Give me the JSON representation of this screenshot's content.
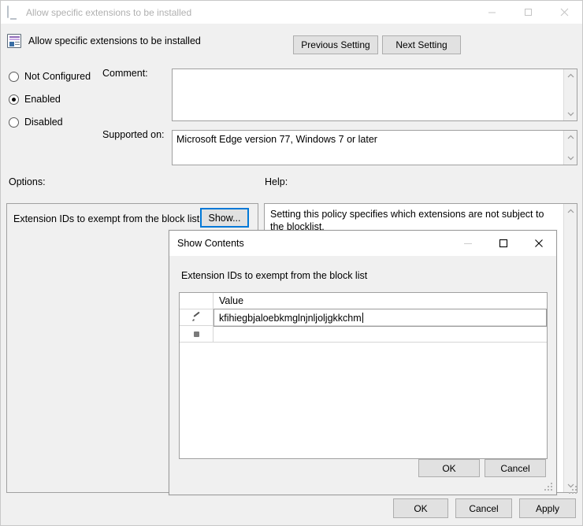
{
  "window": {
    "titlebar_title": "Allow specific extensions to be installed",
    "icon": "monitor-icon",
    "minimize": "–",
    "maximize": "□",
    "close": "✕"
  },
  "policy": {
    "icon": "policy-setting-icon",
    "title": "Allow specific extensions to be installed",
    "prev_setting": "Previous Setting",
    "next_setting": "Next Setting"
  },
  "state": {
    "options": [
      {
        "label": "Not Configured",
        "selected": false
      },
      {
        "label": "Enabled",
        "selected": true
      },
      {
        "label": "Disabled",
        "selected": false
      }
    ]
  },
  "comment": {
    "label": "Comment:",
    "value": "",
    "scroll_up": "⌃",
    "scroll_down": "⌄"
  },
  "supported_on": {
    "label": "Supported on:",
    "value": "Microsoft Edge version 77, Windows 7 or later",
    "scroll_up": "⌃",
    "scroll_down": "⌄"
  },
  "panes": {
    "options_label": "Options:",
    "help_label": "Help:"
  },
  "options": {
    "setting_label": "Extension IDs to exempt from the block list",
    "show_button": "Show..."
  },
  "help": {
    "text": "Setting this policy specifies which extensions are not subject to the blocklist.",
    "scroll_up": "⌃",
    "scroll_down": "⌄"
  },
  "footer": {
    "ok": "OK",
    "cancel": "Cancel",
    "apply": "Apply"
  },
  "modal": {
    "title": "Show Contents",
    "minimize": "–",
    "maximize": "□",
    "close": "✕",
    "label": "Extension IDs to exempt from the block list",
    "grid": {
      "columns": [
        "",
        "Value"
      ],
      "rows": [
        {
          "marker": "pencil-icon",
          "value": "kfihiegbjaloebkmglnjnljoljgkkchm",
          "editing": true
        },
        {
          "marker": "asterisk-icon",
          "value": "",
          "editing": false
        }
      ]
    },
    "ok": "OK",
    "cancel": "Cancel"
  },
  "colors": {
    "accent": "#0078d7",
    "window_bg": "#f0f0f0",
    "field_bg": "#ffffff",
    "button_bg": "#e1e1e1",
    "border": "#a0a0a0"
  }
}
